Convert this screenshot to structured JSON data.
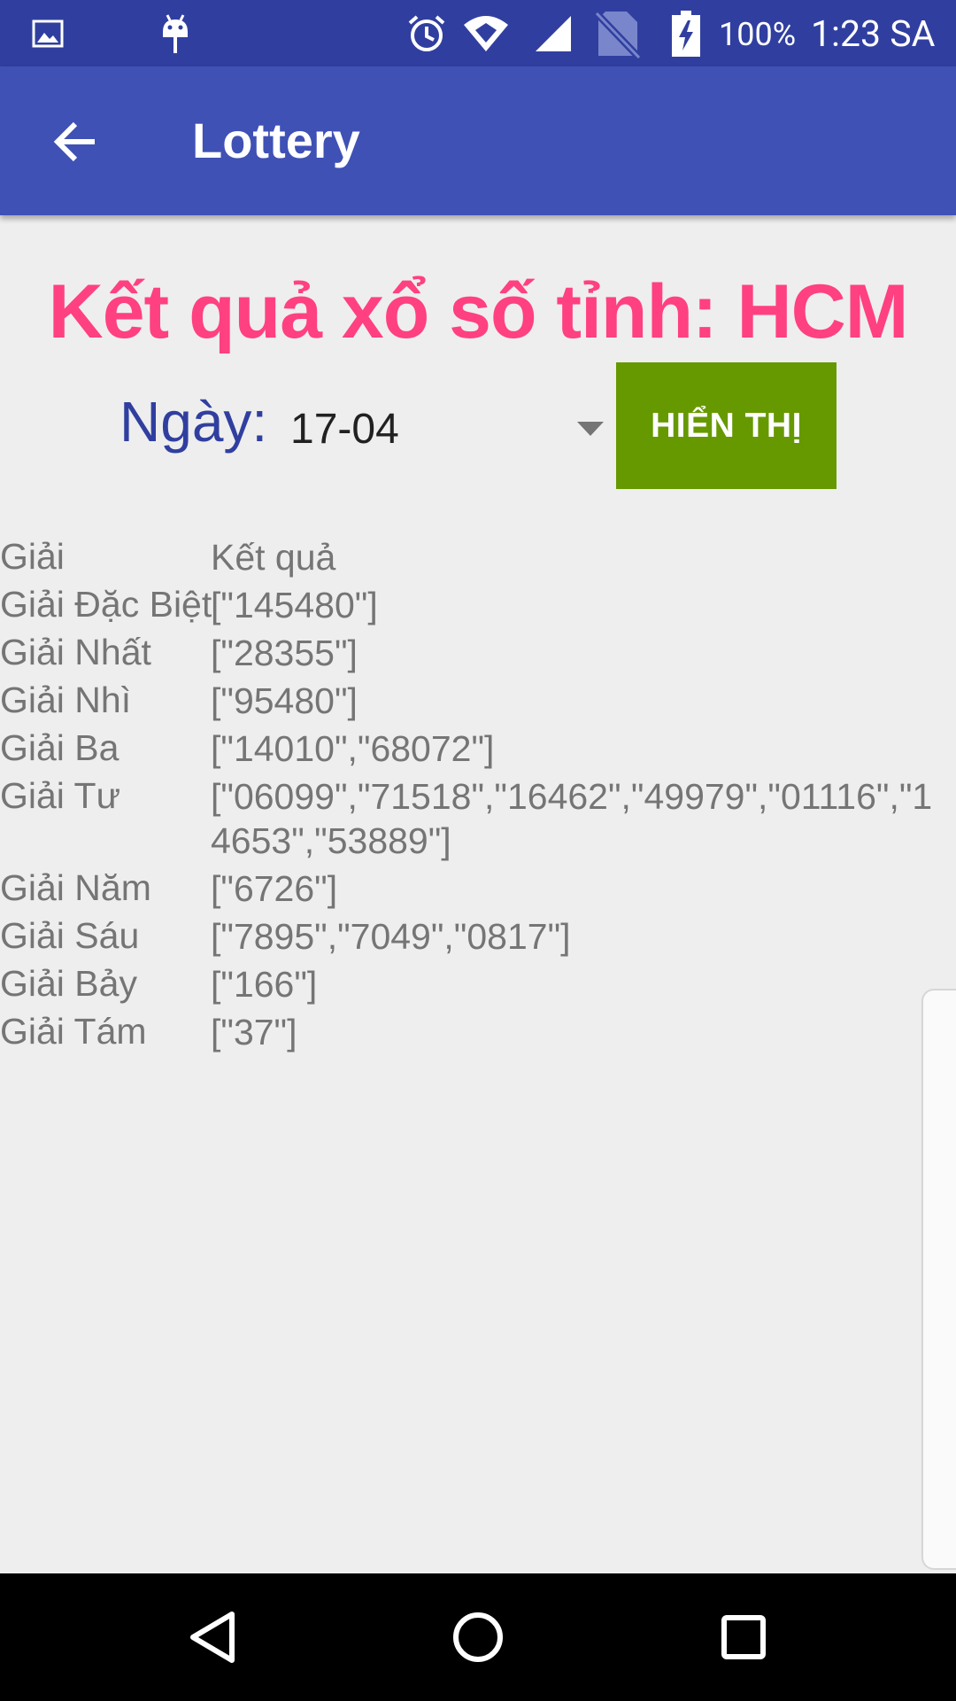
{
  "status_bar": {
    "icons": [
      "image-icon",
      "android-debug-icon",
      "alarm-icon",
      "wifi-icon",
      "signal-icon",
      "no-sim-icon",
      "battery-charging-icon"
    ],
    "battery_percent": "100%",
    "time": "1:23 SA"
  },
  "app_bar": {
    "title": "Lottery",
    "back_icon": "arrow-left-icon"
  },
  "heading": "Kết quả xổ số tỉnh: HCM",
  "date": {
    "label": "Ngày:",
    "selected": "17-04"
  },
  "show_button": {
    "label": "HIỂN THỊ",
    "color": "#669900"
  },
  "table": {
    "header": {
      "name": "Giải",
      "value": "Kết quả"
    },
    "rows": [
      {
        "name": "Giải Đặc Biệt",
        "value": "[\"145480\"]"
      },
      {
        "name": "Giải Nhất",
        "value": "[\"28355\"]"
      },
      {
        "name": "Giải Nhì",
        "value": "[\"95480\"]"
      },
      {
        "name": "Giải Ba",
        "value": "[\"14010\",\"68072\"]"
      },
      {
        "name": "Giải Tư",
        "value": "[\"06099\",\"71518\",\"16462\",\"49979\",\"01116\",\"14653\",\"53889\"]"
      },
      {
        "name": "Giải Năm",
        "value": "[\"6726\"]"
      },
      {
        "name": "Giải Sáu",
        "value": "[\"7895\",\"7049\",\"0817\"]"
      },
      {
        "name": "Giải Bảy",
        "value": "[\"166\"]"
      },
      {
        "name": "Giải Tám",
        "value": "[\"37\"]"
      }
    ]
  },
  "nav_bar": {
    "icons": [
      "back-triangle-icon",
      "home-circle-icon",
      "recents-square-icon"
    ]
  },
  "colors": {
    "status_bar": "#303f9f",
    "app_bar": "#3f51b5",
    "heading": "#ff4081",
    "date_label": "#303f9f",
    "row_text": "#757575"
  }
}
